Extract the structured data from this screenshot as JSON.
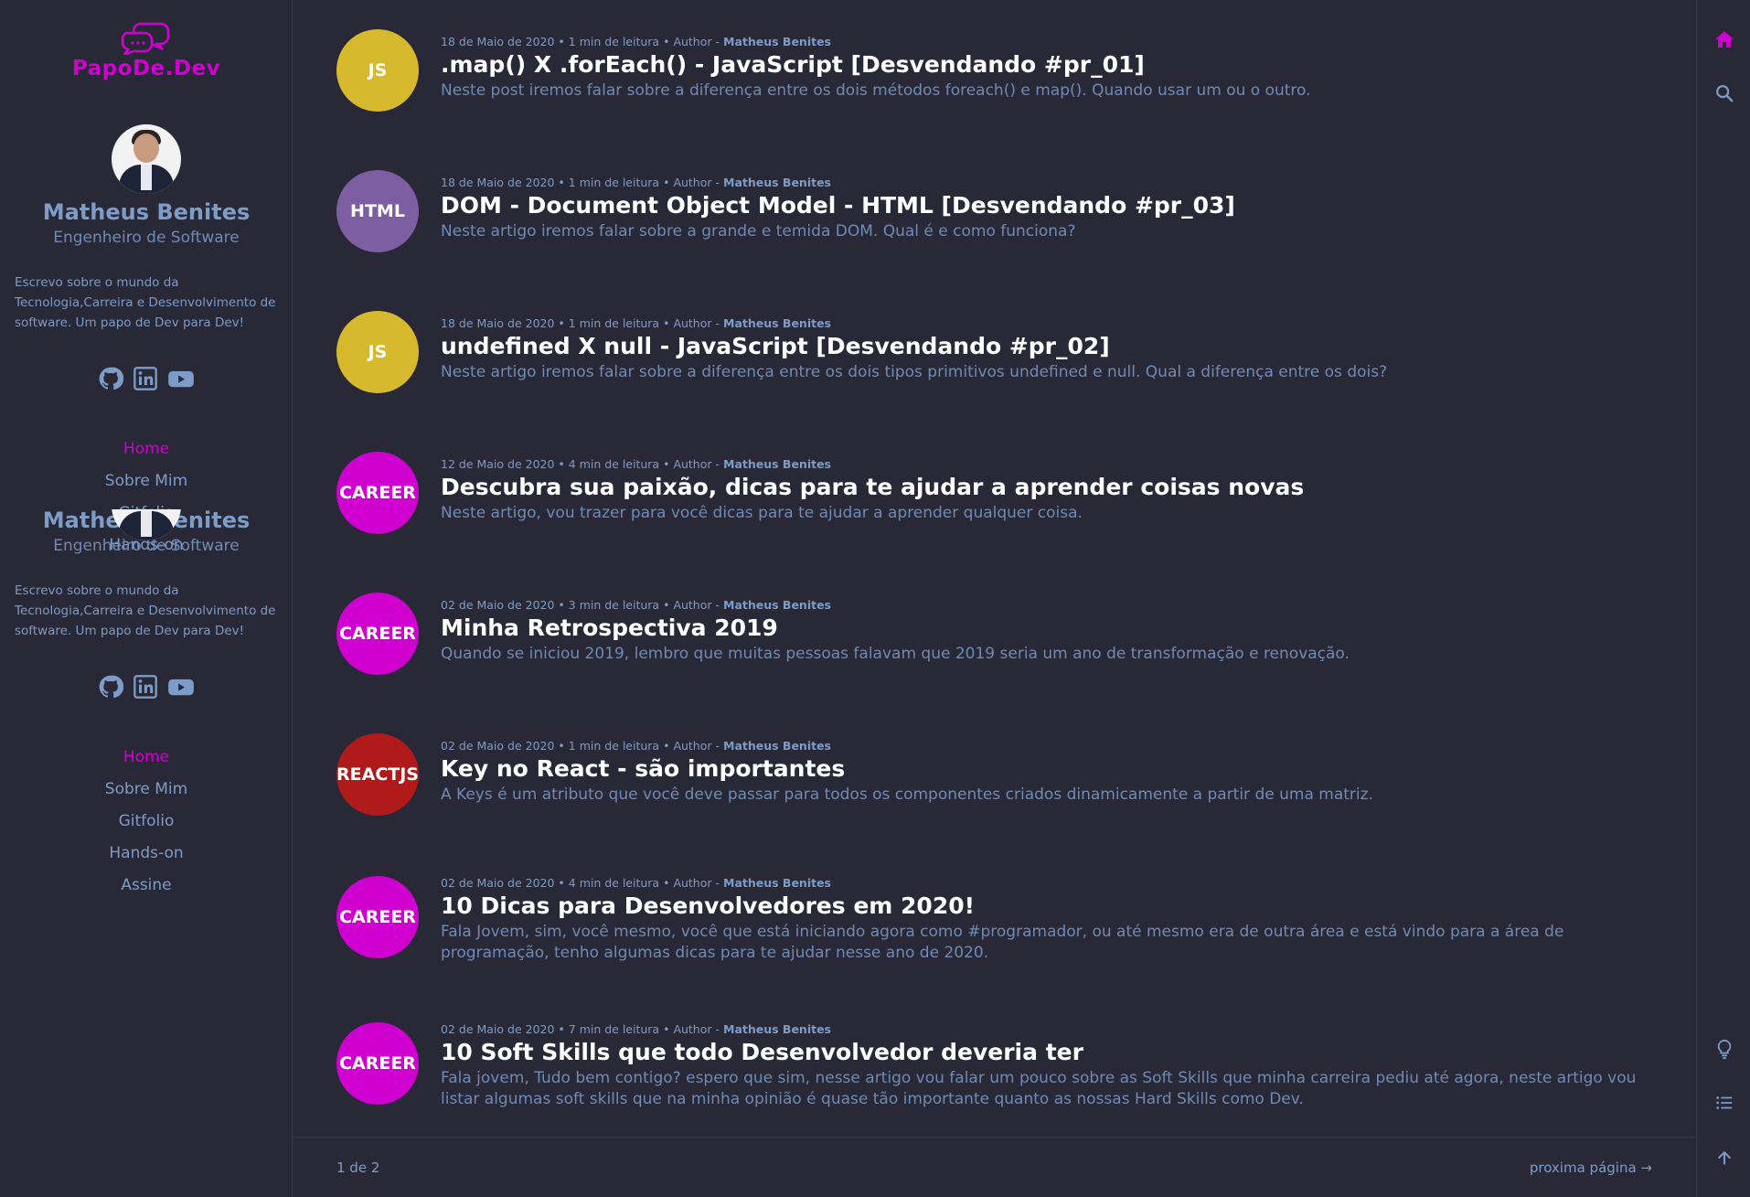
{
  "brand": {
    "name": "PapoDe.Dev",
    "color": "#d000d0"
  },
  "author": {
    "name": "Matheus Benites",
    "position": "Engenheiro de Software",
    "description": "Escrevo sobre o mundo da Tecnologia,Carreira e Desenvolvimento de software. Um papo de Dev para Dev!"
  },
  "socials": [
    {
      "name": "github-icon"
    },
    {
      "name": "linkedin-icon"
    },
    {
      "name": "youtube-icon"
    }
  ],
  "nav_top": [
    "Home",
    "Sobre Mim",
    "Gitfolio",
    "Hands-on"
  ],
  "nav_bottom": [
    "Home",
    "Sobre Mim",
    "Gitfolio",
    "Hands-on",
    "Assine"
  ],
  "meta_labels": {
    "reading": "min de leitura",
    "author_prefix": "Author -"
  },
  "posts": [
    {
      "tag": "JS",
      "color": "#d6b92d",
      "date": "18 de Maio de 2020",
      "read": "1 min de leitura",
      "author": "Matheus Benites",
      "title": ".map() X .forEach() - JavaScript [Desvendando #pr_01]",
      "desc": "Neste post iremos falar sobre a diferença entre os dois métodos foreach() e map(). Quando usar um ou o outro."
    },
    {
      "tag": "HTML",
      "color": "#7d5ea3",
      "date": "18 de Maio de 2020",
      "read": "1 min de leitura",
      "author": "Matheus Benites",
      "title": "DOM - Document Object Model - HTML [Desvendando #pr_03]",
      "desc": "Neste artigo iremos falar sobre a grande e temida DOM. Qual é e como funciona?"
    },
    {
      "tag": "JS",
      "color": "#d6b92d",
      "date": "18 de Maio de 2020",
      "read": "1 min de leitura",
      "author": "Matheus Benites",
      "title": "undefined X null - JavaScript [Desvendando #pr_02]",
      "desc": "Neste artigo iremos falar sobre a diferença entre os dois tipos primitivos undefined e null. Qual a diferença entre os dois?"
    },
    {
      "tag": "CAREER",
      "color": "#d000d0",
      "date": "12 de Maio de 2020",
      "read": "4 min de leitura",
      "author": "Matheus Benites",
      "title": "Descubra sua paixão, dicas para te ajudar a aprender coisas novas",
      "desc": "Neste artigo, vou trazer para você dicas para te ajudar a aprender qualquer coisa."
    },
    {
      "tag": "CAREER",
      "color": "#d000d0",
      "date": "02 de Maio de 2020",
      "read": "3 min de leitura",
      "author": "Matheus Benites",
      "title": "Minha Retrospectiva 2019",
      "desc": "Quando se iniciou 2019, lembro que muitas pessoas falavam que 2019 seria um ano de transformação e renovação."
    },
    {
      "tag": "REACTJS",
      "color": "#b01a1a",
      "date": "02 de Maio de 2020",
      "read": "1 min de leitura",
      "author": "Matheus Benites",
      "title": "Key no React - são importantes",
      "desc": "A Keys é um atributo que você deve passar para todos os componentes criados dinamicamente a partir de uma matriz."
    },
    {
      "tag": "CAREER",
      "color": "#d000d0",
      "date": "02 de Maio de 2020",
      "read": "4 min de leitura",
      "author": "Matheus Benites",
      "title": "10 Dicas para Desenvolvedores em 2020!",
      "desc": "Fala Jovem, sim, você mesmo, você que está iniciando agora como #programador, ou até mesmo era de outra área e está vindo para a área de programação, tenho algumas dicas para te ajudar nesse ano de 2020."
    },
    {
      "tag": "CAREER",
      "color": "#d000d0",
      "date": "02 de Maio de 2020",
      "read": "7 min de leitura",
      "author": "Matheus Benites",
      "title": "10 Soft Skills que todo Desenvolvedor deveria ter",
      "desc": "Fala jovem, Tudo bem contigo? espero que sim, nesse artigo vou falar um pouco sobre as Soft Skills que minha carreira pediu até agora, neste artigo vou listar algumas soft skills que na minha opinião é quase tão importante quanto as nossas Hard Skills como Dev."
    }
  ],
  "pagination": {
    "count": "1 de 2",
    "next": "proxima página →"
  },
  "rightbar": [
    {
      "name": "home-icon",
      "color": "#d000d0"
    },
    {
      "name": "search-icon"
    },
    {
      "name": "lightbulb-icon"
    },
    {
      "name": "list-icon"
    },
    {
      "name": "arrow-up-icon"
    }
  ],
  "colors": {
    "bg": "#292837",
    "text": "#7d9cc7",
    "accent": "#d000d0"
  }
}
